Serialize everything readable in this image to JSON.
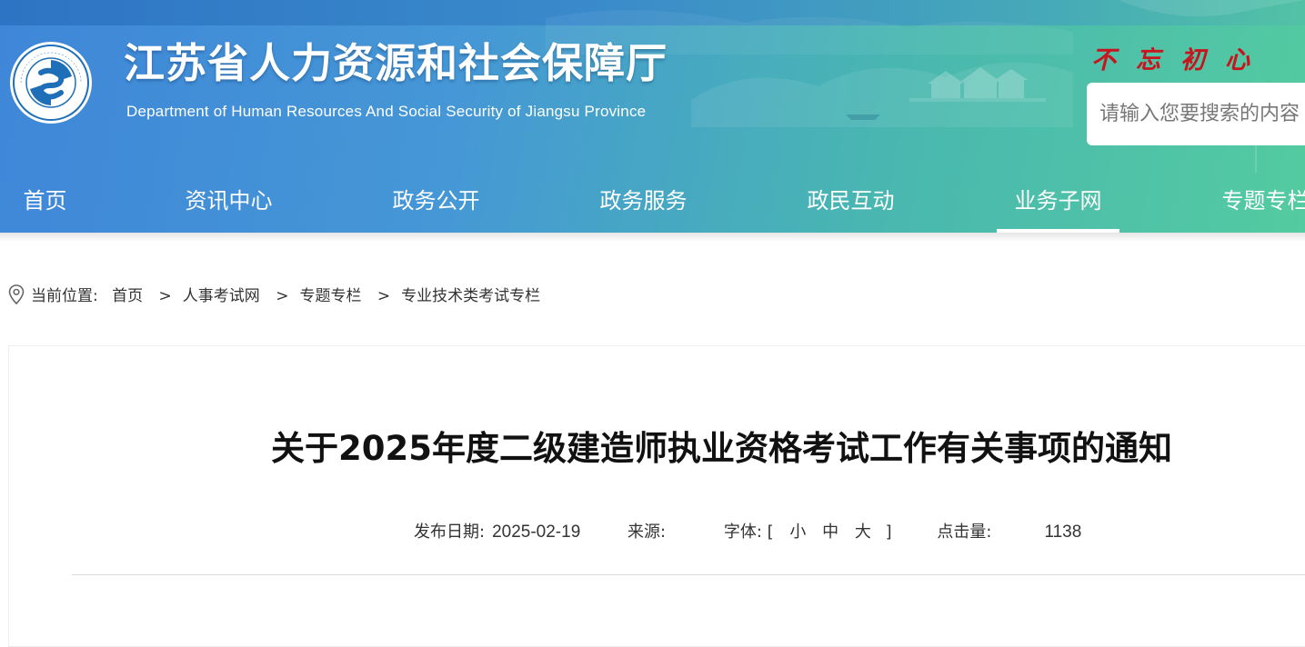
{
  "header": {
    "site_title": "江苏省人力资源和社会保障厅",
    "site_subtitle": "Department of Human Resources And Social Security of Jiangsu Province",
    "slogan": "不忘初心",
    "search_placeholder": "请输入您要搜索的内容",
    "colors": {
      "gradient_start": "#3f86d8",
      "gradient_end": "#54cba0",
      "slogan": "#c8141c"
    }
  },
  "nav": {
    "items": [
      {
        "label": "首页"
      },
      {
        "label": "资讯中心"
      },
      {
        "label": "政务公开"
      },
      {
        "label": "政务服务"
      },
      {
        "label": "政民互动"
      },
      {
        "label": "业务子网",
        "active": true
      },
      {
        "label": "专题专栏"
      }
    ]
  },
  "breadcrumb": {
    "prefix": "当前位置:",
    "items": [
      "首页",
      "人事考试网",
      "专题专栏",
      "专业技术类考试专栏"
    ],
    "separator": ">"
  },
  "article": {
    "title": "关于2025年度二级建造师执业资格考试工作有关事项的通知",
    "date_label": "发布日期:",
    "date": "2025-02-19",
    "source_label": "来源:",
    "font_label": "字体:",
    "bracket_open": "[",
    "font_small": "小",
    "font_medium": "中",
    "font_large": "大",
    "bracket_close": "]",
    "hits_label": "点击量:",
    "hits": "1138"
  }
}
